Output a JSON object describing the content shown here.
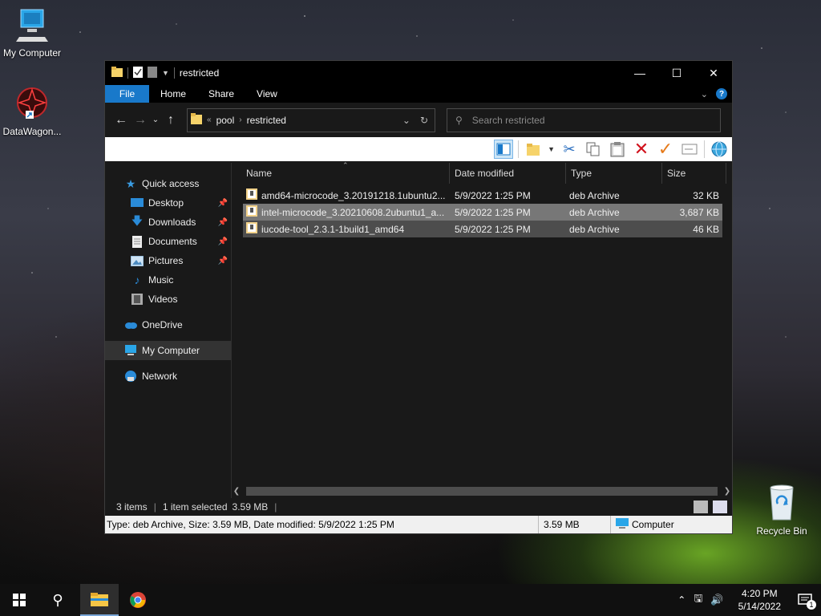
{
  "desktop": {
    "icons": [
      {
        "label": "My Computer"
      },
      {
        "label": "DataWagon..."
      },
      {
        "label": "Recycle Bin"
      }
    ]
  },
  "window": {
    "title": "restricted",
    "ribbon_tabs": [
      "File",
      "Home",
      "Share",
      "View"
    ],
    "address": {
      "prefix": "«",
      "crumbs": [
        "pool",
        "restricted"
      ]
    },
    "search": {
      "placeholder": "Search restricted"
    },
    "nav": {
      "quick_access": "Quick access",
      "items": [
        {
          "label": "Desktop",
          "pinned": true
        },
        {
          "label": "Downloads",
          "pinned": true
        },
        {
          "label": "Documents",
          "pinned": true
        },
        {
          "label": "Pictures",
          "pinned": true
        },
        {
          "label": "Music",
          "pinned": false
        },
        {
          "label": "Videos",
          "pinned": false
        }
      ],
      "onedrive": "OneDrive",
      "my_computer": "My Computer",
      "network": "Network"
    },
    "columns": [
      "Name",
      "Date modified",
      "Type",
      "Size"
    ],
    "files": [
      {
        "name": "amd64-microcode_3.20191218.1ubuntu2...",
        "date": "5/9/2022 1:25 PM",
        "type": "deb Archive",
        "size": "32 KB"
      },
      {
        "name": "intel-microcode_3.20210608.2ubuntu1_a...",
        "date": "5/9/2022 1:25 PM",
        "type": "deb Archive",
        "size": "3,687 KB"
      },
      {
        "name": "iucode-tool_2.3.1-1build1_amd64",
        "date": "5/9/2022 1:25 PM",
        "type": "deb Archive",
        "size": "46 KB"
      }
    ],
    "status": {
      "items": "3 items",
      "selected": "1 item selected",
      "size": "3.59 MB"
    },
    "infobar": {
      "details": "Type: deb Archive, Size: 3.59 MB, Date modified: 5/9/2022 1:25 PM",
      "size": "3.59 MB",
      "location": "Computer"
    }
  },
  "taskbar": {
    "time": "4:20 PM",
    "date": "5/14/2022",
    "notifications": "1"
  },
  "colors": {
    "accent": "#1979ca",
    "window_bg": "#191919",
    "selection": "#777777"
  }
}
